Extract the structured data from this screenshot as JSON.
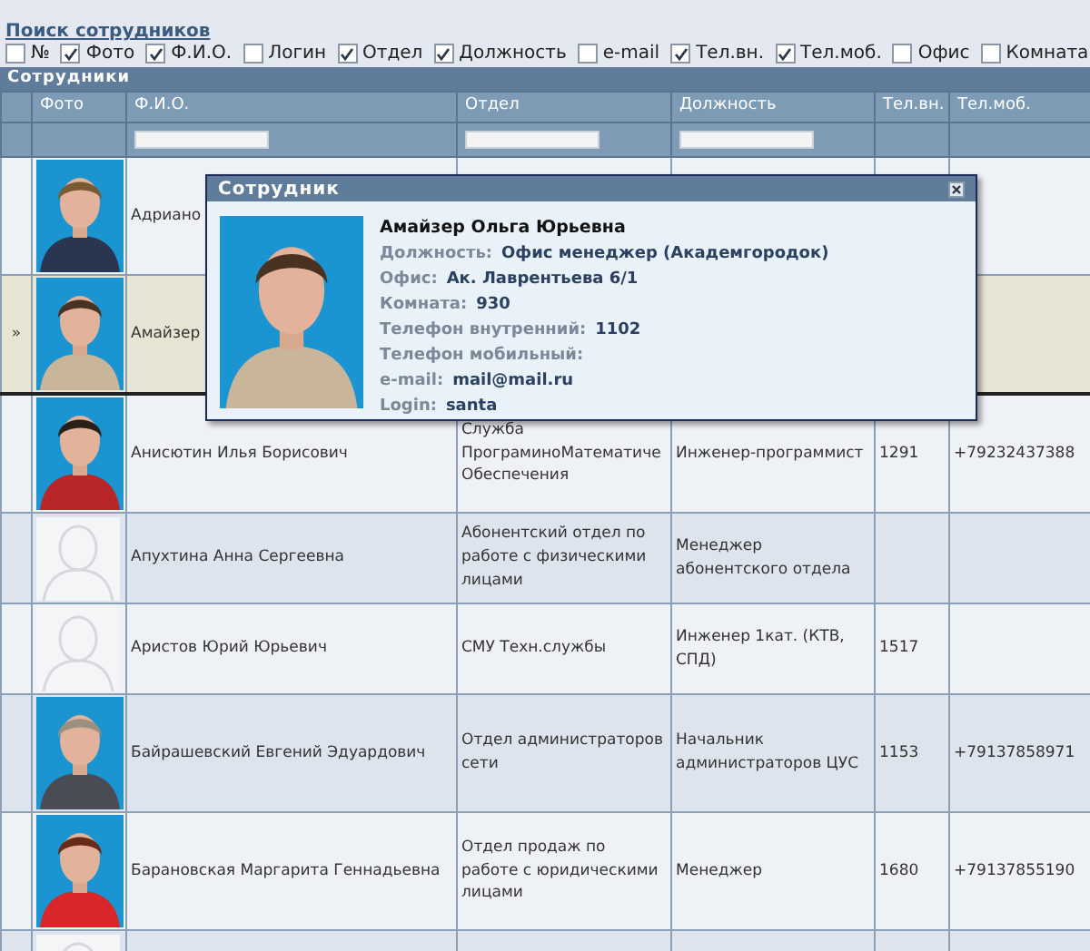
{
  "search_link": "Поиск сотрудников",
  "column_toggles": [
    {
      "label": "№",
      "checked": false
    },
    {
      "label": "Фото",
      "checked": true
    },
    {
      "label": "Ф.И.О.",
      "checked": true
    },
    {
      "label": "Логин",
      "checked": false
    },
    {
      "label": "Отдел",
      "checked": true
    },
    {
      "label": "Должность",
      "checked": true
    },
    {
      "label": "e-mail",
      "checked": false
    },
    {
      "label": "Тел.вн.",
      "checked": true
    },
    {
      "label": "Тел.моб.",
      "checked": true
    },
    {
      "label": "Офис",
      "checked": false
    },
    {
      "label": "Комната",
      "checked": false
    }
  ],
  "panel_title": "Сотрудники",
  "columns": [
    {
      "label": "Фото",
      "filter": false
    },
    {
      "label": "Ф.И.О.",
      "filter": true
    },
    {
      "label": "Отдел",
      "filter": true
    },
    {
      "label": "Должность",
      "filter": true
    },
    {
      "label": "Тел.вн.",
      "filter": false
    },
    {
      "label": "Тел.моб.",
      "filter": false
    }
  ],
  "rows": [
    {
      "name": "Адриано",
      "selected": false
    },
    {
      "marker": "»",
      "name": "Амайзер",
      "selected": true
    },
    {
      "name": "Анисютин Илья Борисович",
      "department": "Служба ПрограминоМатематиче Обеспечения",
      "position": "Инженер-программист",
      "phone": "1291",
      "mobile": "+79232437388",
      "selected": false
    },
    {
      "photo": {
        "kind": "placeholder"
      },
      "name": "Апухтина Анна Сергеевна",
      "department": "Абонентский отдел по работе с физическими лицами",
      "position": "Менеджер абонентского отдела",
      "selected": false
    },
    {
      "photo": {
        "kind": "placeholder"
      },
      "name": "Аристов Юрий Юрьевич",
      "department": "СМУ Техн.службы",
      "position": "Инженер 1кат. (КТВ, СПД)",
      "phone": "1517",
      "selected": false
    },
    {
      "name": "Байрашевский Евгений Эдуардович",
      "department": "Отдел администраторов сети",
      "position": "Начальник администраторов ЦУС",
      "phone": "1153",
      "mobile": "+79137858971",
      "selected": false
    },
    {
      "name": "Барановская Маргарита Геннадьевна",
      "department": "Отдел продаж по работе с юридическими лицами",
      "position": "Менеджер",
      "phone": "1680",
      "mobile": "+79137855190",
      "selected": false
    },
    {
      "photo": {
        "kind": "placeholder"
      },
      "selected": false
    }
  ],
  "popup": {
    "title": "Сотрудник",
    "name": "Амайзер Ольга Юрьевна",
    "fields": [
      {
        "label": "Должность:",
        "value": "Офис менеджер (Академгородок)"
      },
      {
        "label": "Офис:",
        "value": "Ак. Лаврентьева 6/1"
      },
      {
        "label": "Комната:",
        "value": "930"
      },
      {
        "label": "Телефон внутренний:",
        "value": "1102"
      },
      {
        "label": "Телефон мобильный:"
      },
      {
        "label": "e-mail:",
        "value": "mail@mail.ru"
      },
      {
        "label": "Login:",
        "value": "santa"
      }
    ]
  }
}
